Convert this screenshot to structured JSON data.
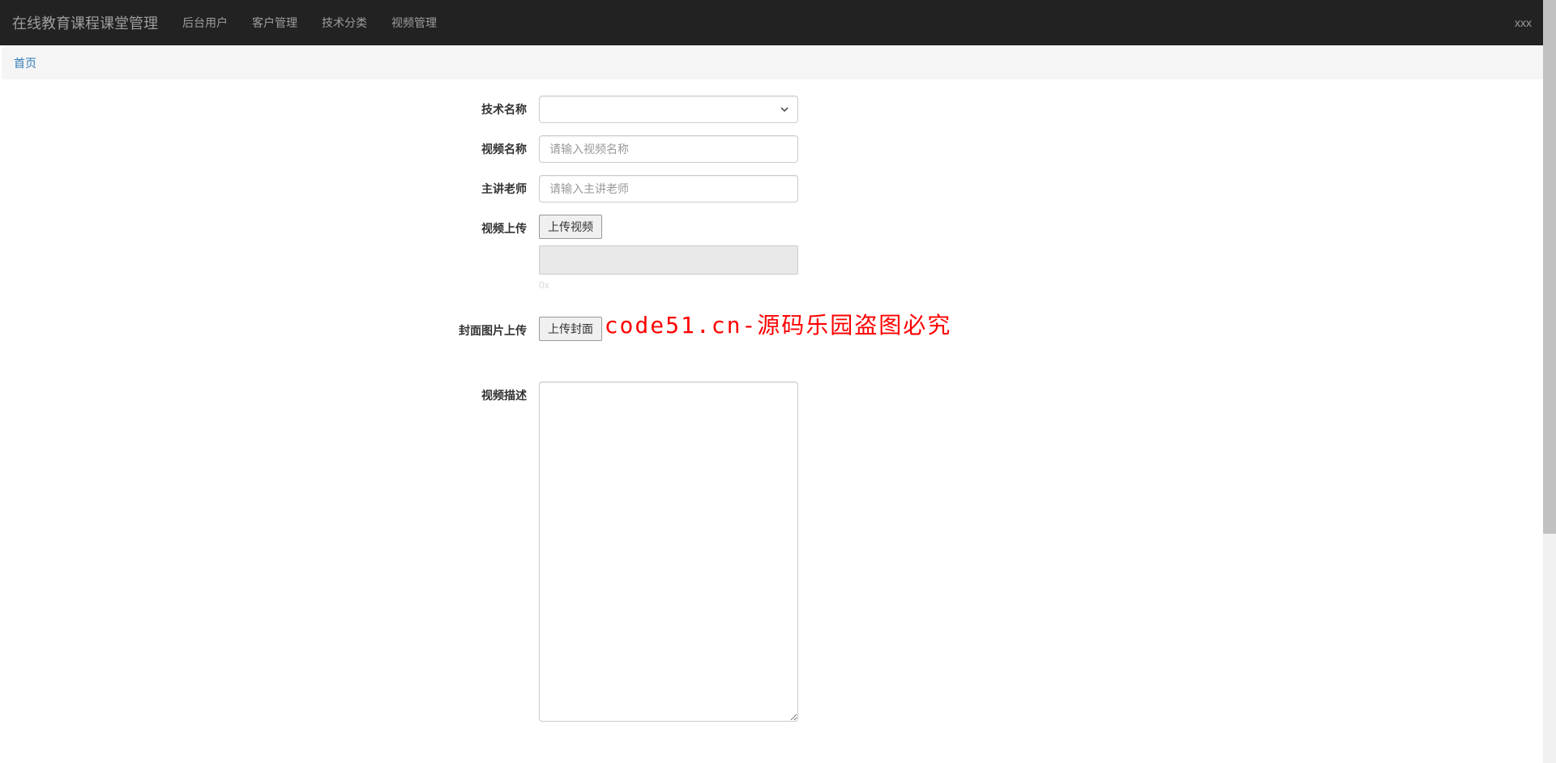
{
  "navbar": {
    "brand": "在线教育课程课堂管理",
    "items": [
      {
        "label": "后台用户"
      },
      {
        "label": "客户管理"
      },
      {
        "label": "技术分类"
      },
      {
        "label": "视频管理"
      }
    ],
    "user": "xxx"
  },
  "breadcrumb": {
    "home": "首页"
  },
  "form": {
    "techName": {
      "label": "技术名称",
      "value": ""
    },
    "videoName": {
      "label": "视频名称",
      "placeholder": "请输入视频名称",
      "value": ""
    },
    "teacher": {
      "label": "主讲老师",
      "placeholder": "请输入主讲老师",
      "value": ""
    },
    "videoUpload": {
      "label": "视频上传",
      "button": "上传视频",
      "hint": "0x"
    },
    "coverUpload": {
      "label": "封面图片上传",
      "button": "上传封面"
    },
    "description": {
      "label": "视频描述",
      "value": ""
    }
  },
  "watermark": "code51.cn-源码乐园盗图必究"
}
